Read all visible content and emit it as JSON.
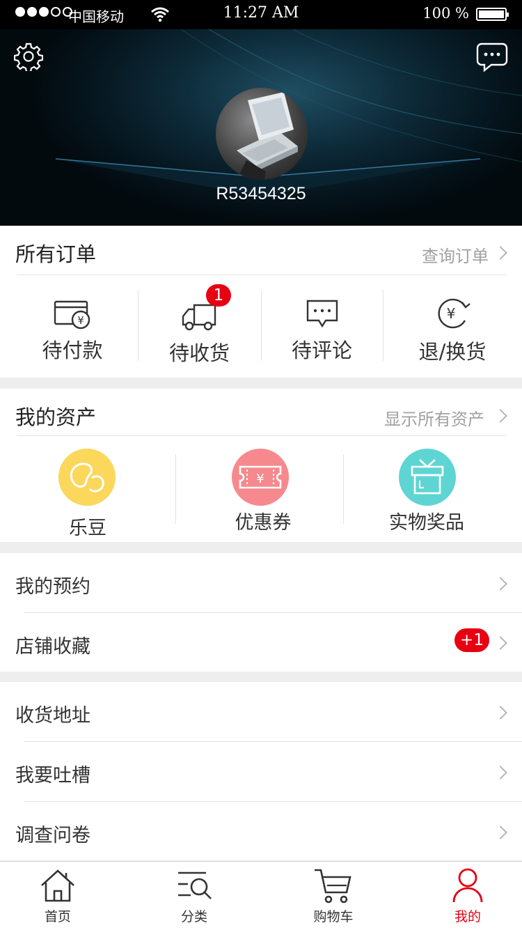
{
  "status_bar": {
    "carrier": "中国移动",
    "time": "11:27 AM",
    "battery_text": "100 %"
  },
  "profile": {
    "username": "R53454325"
  },
  "orders": {
    "title": "所有订单",
    "link": "查询订单",
    "items": [
      {
        "label": "待付款",
        "icon": "wallet-yen-icon"
      },
      {
        "label": "待收货",
        "icon": "delivery-truck-icon",
        "badge": "1"
      },
      {
        "label": "待评论",
        "icon": "comment-bubble-icon"
      },
      {
        "label": "退/换货",
        "icon": "yen-refresh-icon"
      }
    ]
  },
  "assets": {
    "title": "我的资产",
    "link": "显示所有资产",
    "items": [
      {
        "label": "乐豆",
        "icon": "bean-icon",
        "color": "#fbd75b"
      },
      {
        "label": "优惠券",
        "icon": "coupon-icon",
        "color": "#f6898e"
      },
      {
        "label": "实物奖品",
        "icon": "gift-box-icon",
        "color": "#5fd5d3"
      }
    ]
  },
  "menu_group_1": [
    {
      "label": "我的预约"
    },
    {
      "label": "店铺收藏",
      "badge": "+1"
    }
  ],
  "menu_group_2": [
    {
      "label": "收货地址"
    },
    {
      "label": "我要吐槽"
    },
    {
      "label": "调查问卷"
    }
  ],
  "tabbar": {
    "items": [
      {
        "label": "首页",
        "icon": "home-icon"
      },
      {
        "label": "分类",
        "icon": "category-search-icon"
      },
      {
        "label": "购物车",
        "icon": "cart-icon"
      },
      {
        "label": "我的",
        "icon": "user-icon",
        "active": true
      }
    ],
    "accent": "#e60012"
  }
}
